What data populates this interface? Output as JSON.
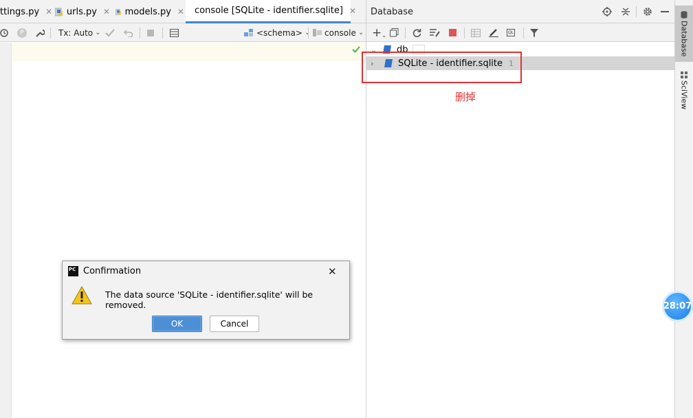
{
  "editor_tabs": [
    {
      "label": "ttings.py",
      "close": "✕"
    },
    {
      "label": "urls.py",
      "close": "✕"
    },
    {
      "label": "models.py",
      "close": "✕"
    },
    {
      "label": "console [SQLite - identifier.sqlite]",
      "close": "✕"
    }
  ],
  "editor_toolbar": {
    "tx_mode": "Tx: Auto",
    "schema": "<schema>",
    "session": "console",
    "p_badge": "P"
  },
  "database_panel": {
    "title": "Database",
    "tree": [
      {
        "label": "db",
        "count": ""
      },
      {
        "label": "SQLite - identifier.sqlite",
        "count": "1"
      }
    ]
  },
  "annotation": {
    "text": "删掉",
    "color": "#e03030"
  },
  "right_stripe": {
    "tabs": [
      "Database",
      "SciView"
    ]
  },
  "dialog": {
    "title": "Confirmation",
    "message": "The data source 'SQLite - identifier.sqlite' will be removed.",
    "ok_label": "OK",
    "cancel_label": "Cancel"
  },
  "clock_widget": {
    "time": "28:07"
  },
  "colors": {
    "accent_blue": "#4083c9",
    "ok_button": "#4d8fd6",
    "checkmark": "#4caf50",
    "stop": "#e05555"
  }
}
